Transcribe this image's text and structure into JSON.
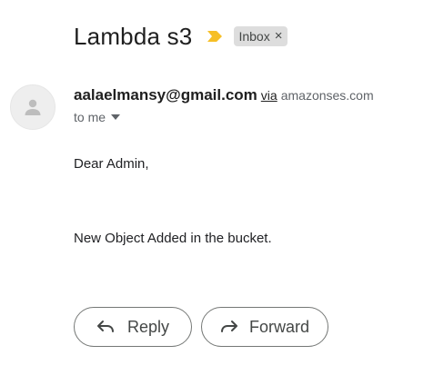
{
  "email": {
    "subject": "Lambda s3",
    "label": "Inbox",
    "label_remove": "×",
    "sender_email": "aalaelmansy@gmail.com",
    "via_text": "via",
    "via_domain": "amazonses.com",
    "recipient_text": "to me",
    "body_lines": [
      "Dear Admin,",
      "New Object Added in the bucket."
    ]
  },
  "actions": {
    "reply_label": "Reply",
    "forward_label": "Forward"
  },
  "icons": {
    "importance": "importance-marker-icon",
    "avatar": "person-icon",
    "caret": "chevron-down-icon",
    "reply": "reply-arrow-icon",
    "forward": "forward-arrow-icon"
  },
  "colors": {
    "importance": "#f6bf26",
    "chip_bg": "#dddddd",
    "button_border": "#747775"
  }
}
